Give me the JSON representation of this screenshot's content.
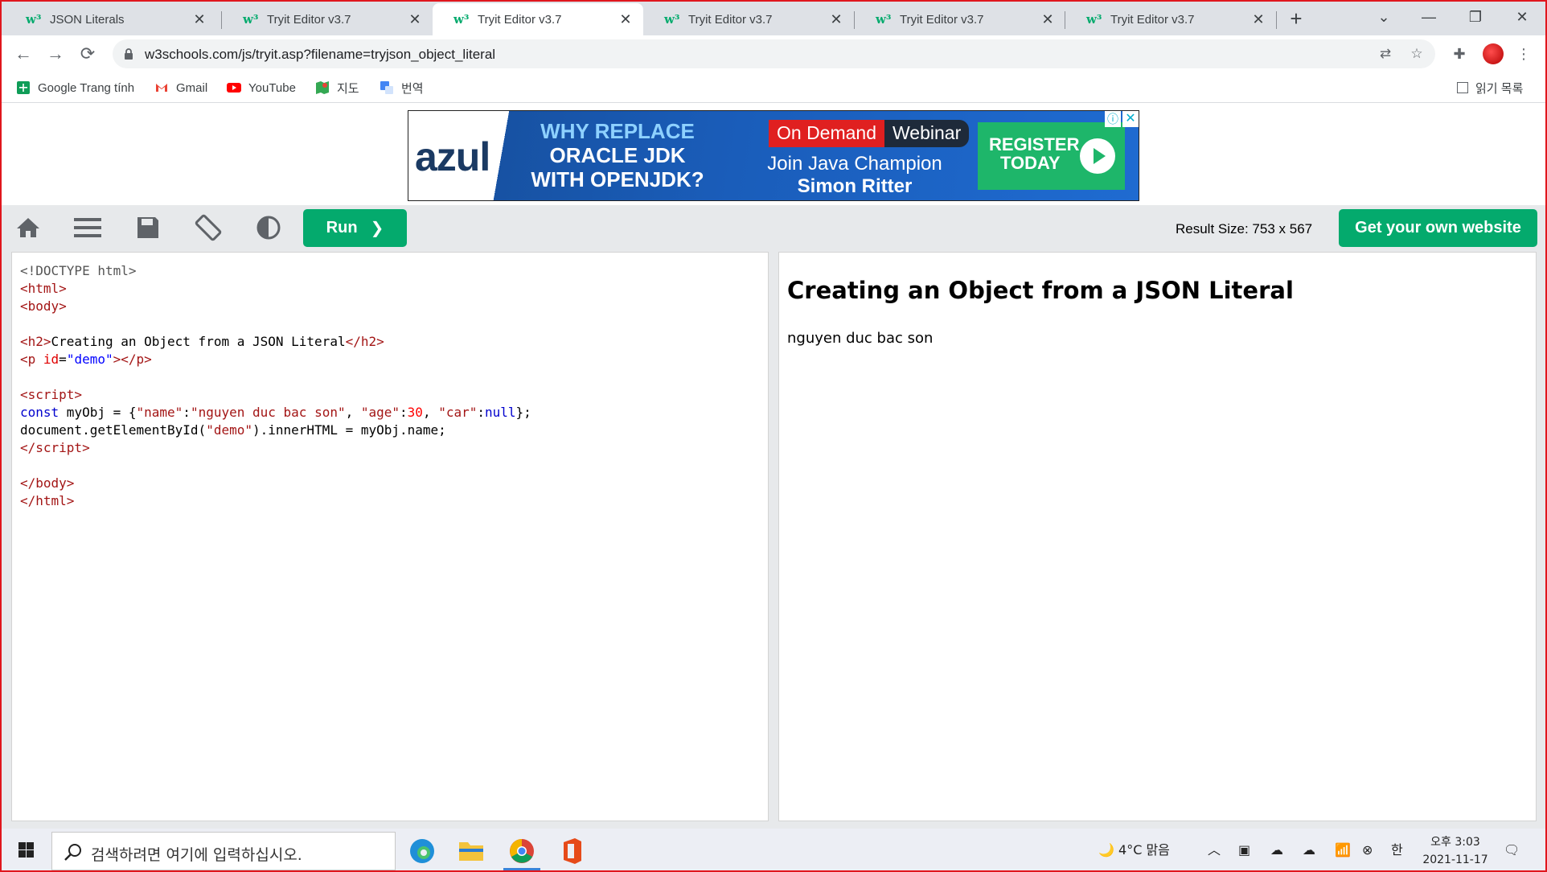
{
  "tabs": [
    {
      "title": "JSON Literals",
      "active": false
    },
    {
      "title": "Tryit Editor v3.7",
      "active": false
    },
    {
      "title": "Tryit Editor v3.7",
      "active": true
    },
    {
      "title": "Tryit Editor v3.7",
      "active": false
    },
    {
      "title": "Tryit Editor v3.7",
      "active": false
    },
    {
      "title": "Tryit Editor v3.7",
      "active": false
    }
  ],
  "tab_close_glyph": "✕",
  "new_tab_glyph": "+",
  "window_controls": {
    "dropdown": "⌄",
    "minimize": "—",
    "restore": "❐",
    "close": "✕"
  },
  "address_bar": {
    "url": "w3schools.com/js/tryit.asp?filename=tryjson_object_literal"
  },
  "bookmarks": [
    {
      "label": "Google Trang tính",
      "icon": "sheets-icon"
    },
    {
      "label": "Gmail",
      "icon": "gmail-icon"
    },
    {
      "label": "YouTube",
      "icon": "youtube-icon"
    },
    {
      "label": "지도",
      "icon": "maps-icon"
    },
    {
      "label": "번역",
      "icon": "translate-icon"
    }
  ],
  "reading_list": "읽기 목록",
  "ad": {
    "logo": "azul",
    "headline_1": "WHY REPLACE",
    "headline_2": "ORACLE JDK",
    "headline_3": "WITH OPENJDK?",
    "on_demand": "On Demand",
    "webinar": "Webinar",
    "join": "Join Java Champion",
    "speaker": "Simon Ritter",
    "register_1": "REGISTER",
    "register_2": "TODAY"
  },
  "tryit": {
    "run_label": "Run",
    "result_size": "Result Size: 753 x 567",
    "get_website_label": "Get your own website"
  },
  "result": {
    "heading": "Creating an Object from a JSON Literal",
    "text": "nguyen duc bac son"
  },
  "code": {
    "doctype": "<!DOCTYPE html>",
    "h2_text": "Creating an Object from a JSON Literal",
    "p_id": "\"demo\"",
    "const_kw": "const",
    "obj_decl": " myObj = {",
    "k_name": "\"name\"",
    "v_name": "\"nguyen duc bac son\"",
    "k_age": "\"age\"",
    "v_age": "30",
    "k_car": "\"car\"",
    "v_car": "null",
    "dom_line_a": "document.getElementById(",
    "dom_arg": "\"demo\"",
    "dom_line_b": ").innerHTML = myObj.name;"
  },
  "taskbar": {
    "search_placeholder": "검색하려면 여기에 입력하십시오.",
    "weather": "4°C  맑음",
    "ime": "한",
    "time": "오후 3:03",
    "date": "2021-11-17"
  },
  "colors": {
    "accent_green": "#04aa6d",
    "frame_red": "#e0161d",
    "chrome_tabbar": "#dee1e6"
  }
}
